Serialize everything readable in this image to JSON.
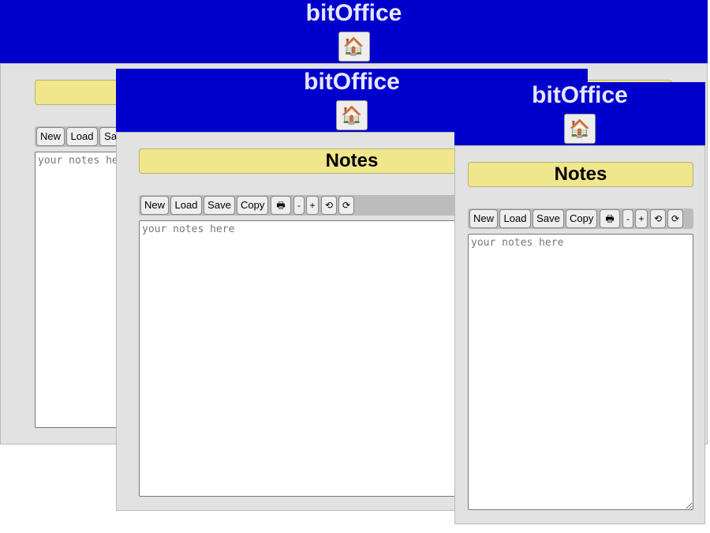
{
  "app": {
    "brand": "bitOffice",
    "home_icon": "🏠",
    "title": "Notes"
  },
  "toolbar": {
    "new": "New",
    "load": "Load",
    "save": "Save",
    "copy": "Copy",
    "print_icon": "🖶",
    "zoom_out": "-",
    "zoom_in": "+",
    "undo": "⟲",
    "redo": "⟳"
  },
  "notes": {
    "placeholder": "your notes here"
  },
  "colors": {
    "header_bg": "#0000cc",
    "brand_text": "#e6e6ff",
    "title_bg": "#f0e68c",
    "panel_bg": "#e2e2e2"
  }
}
